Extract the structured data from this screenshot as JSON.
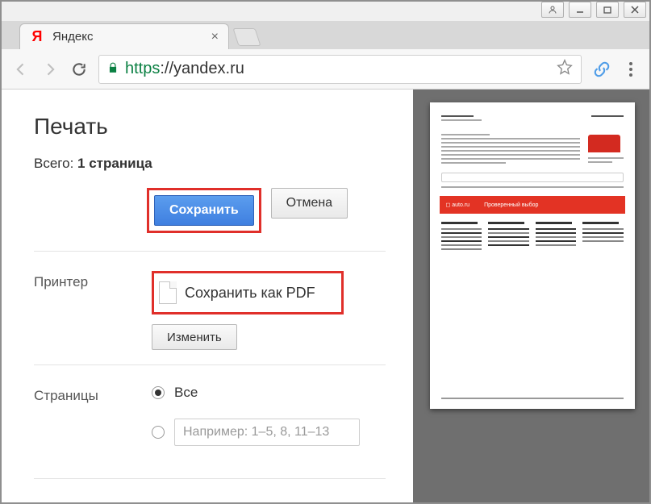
{
  "window": {
    "caption_user_icon": "user-icon",
    "caption_min": "—",
    "caption_max": "❐",
    "caption_close": "✕"
  },
  "tab": {
    "title": "Яндекс",
    "logo_letter": "Я"
  },
  "toolbar": {
    "url_scheme": "https",
    "url_rest": "://yandex.ru"
  },
  "print": {
    "title": "Печать",
    "total_label": "Всего:",
    "total_value": "1 страница",
    "save_label": "Сохранить",
    "cancel_label": "Отмена",
    "printer_section_label": "Принтер",
    "printer_value": "Сохранить как PDF",
    "change_label": "Изменить",
    "pages_section_label": "Страницы",
    "pages_all_label": "Все",
    "pages_range_placeholder": "Например: 1–5, 8, 11–13"
  },
  "preview": {
    "banner_logo": "◻ auto.ru",
    "banner_text": "Проверенный выбор"
  }
}
